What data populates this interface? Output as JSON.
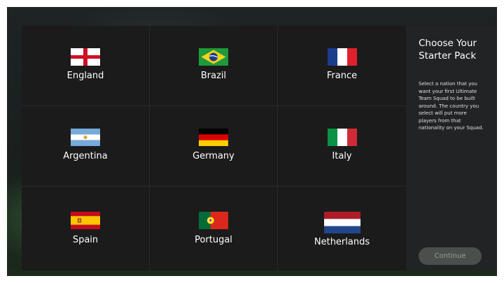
{
  "nations": [
    {
      "name": "England",
      "flag": "england-flag"
    },
    {
      "name": "Brazil",
      "flag": "brazil-flag"
    },
    {
      "name": "France",
      "flag": "france-flag"
    },
    {
      "name": "Argentina",
      "flag": "argentina-flag"
    },
    {
      "name": "Germany",
      "flag": "germany-flag"
    },
    {
      "name": "Italy",
      "flag": "italy-flag"
    },
    {
      "name": "Spain",
      "flag": "spain-flag"
    },
    {
      "name": "Portugal",
      "flag": "portugal-flag"
    },
    {
      "name": "Netherlands",
      "flag": "netherlands-flag"
    }
  ],
  "panel": {
    "title": "Choose Your Starter Pack",
    "description": "Select a nation that you want your first Ultimate Team Squad to be built around. The country you select will put more players from that nationality on your Squad.",
    "continue_label": "Continue"
  },
  "colors": {
    "grid_background": "#1b1b1b",
    "panel_background": "#222324",
    "continue_background": "#4b4f4c",
    "continue_text": "#9a9e9b"
  }
}
